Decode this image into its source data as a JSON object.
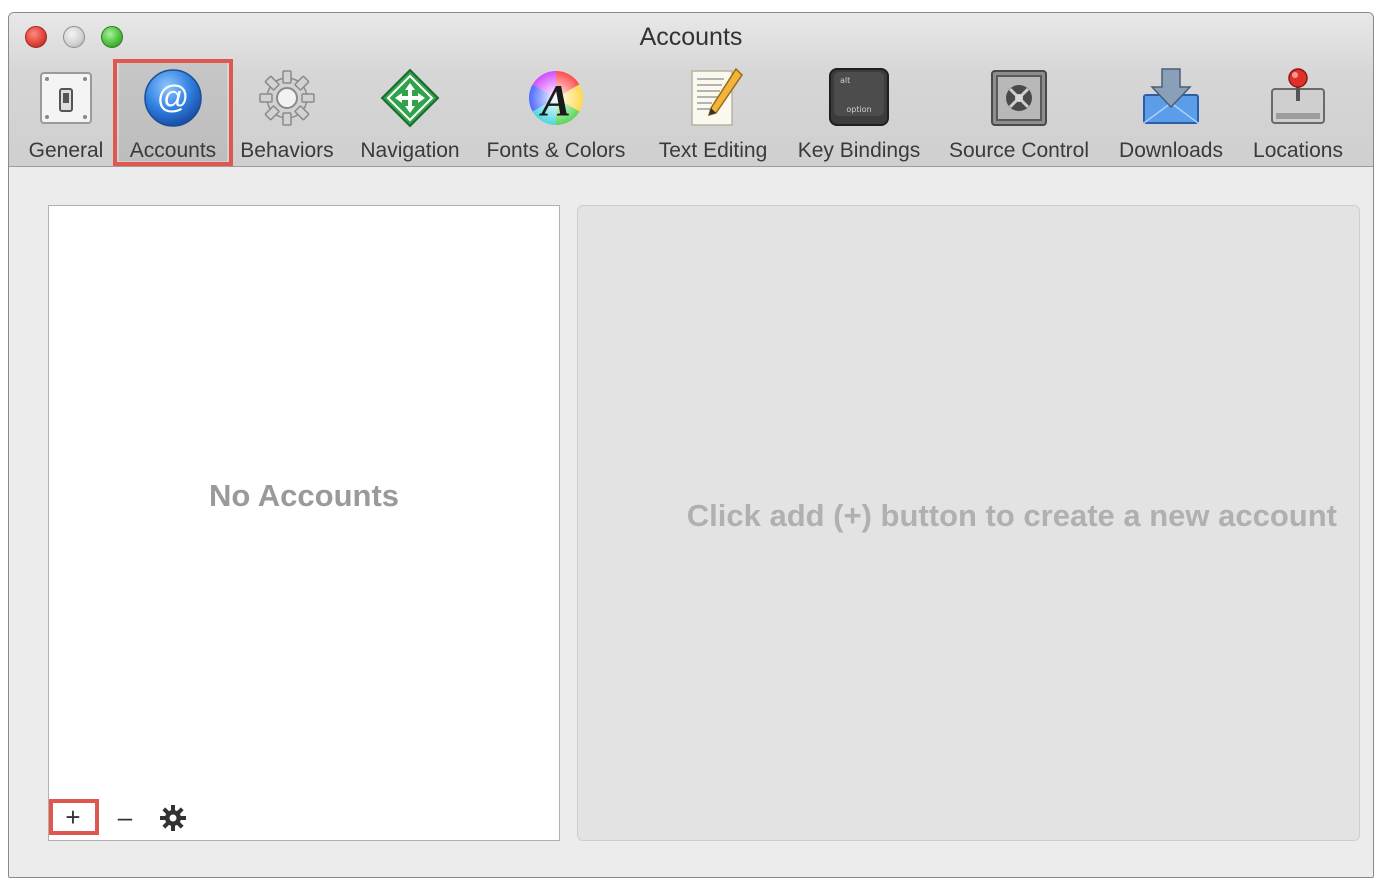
{
  "window": {
    "title": "Accounts"
  },
  "toolbar": {
    "items": [
      {
        "label": "General",
        "icon": "general-switch-icon"
      },
      {
        "label": "Accounts",
        "icon": "at-sign-icon",
        "selected": true
      },
      {
        "label": "Behaviors",
        "icon": "gear-icon"
      },
      {
        "label": "Navigation",
        "icon": "navigation-arrows-icon"
      },
      {
        "label": "Fonts & Colors",
        "icon": "fonts-colors-icon"
      },
      {
        "label": "Text Editing",
        "icon": "text-editing-icon"
      },
      {
        "label": "Key Bindings",
        "icon": "keyboard-key-icon"
      },
      {
        "label": "Source Control",
        "icon": "source-control-vault-icon"
      },
      {
        "label": "Downloads",
        "icon": "downloads-icon"
      },
      {
        "label": "Locations",
        "icon": "locations-drive-icon"
      }
    ],
    "key_icon_top": "alt",
    "key_icon_bottom": "option"
  },
  "accounts_list": {
    "empty_text": "No Accounts",
    "add_label": "+",
    "remove_label": "–",
    "options_icon": "gear-icon"
  },
  "detail": {
    "message": "Click add (+) button to create a new account"
  },
  "colors": {
    "highlight": "#e0574f",
    "accent_blue": "#2f7fe0"
  }
}
